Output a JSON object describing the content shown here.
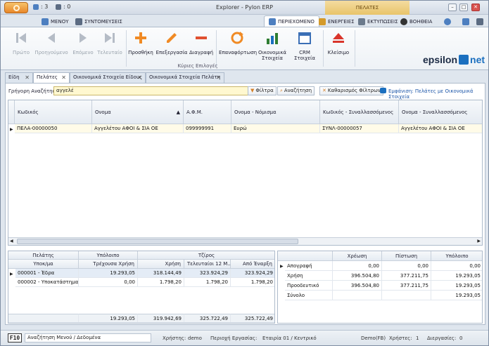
{
  "title_bar": {
    "counter1": ": 3",
    "counter2": ": 0",
    "menu": "ΜΕΝΟΥ",
    "shortcuts": "ΣΥΝΤΟΜΕΥΣΕΙΣ",
    "title": "Explorer - Pylon ERP",
    "context": "ΠΕΛΑΤΕΣ"
  },
  "ribbon_tabs": [
    {
      "label": "ΠΕΡΙΕΧΟΜΕΝΟ"
    },
    {
      "label": "ΕΝΕΡΓΕΙΕΣ"
    },
    {
      "label": "ΕΚΤΥΠΩΣΕΙΣ"
    },
    {
      "label": "ΒΟΗΘΕΙΑ"
    }
  ],
  "ribbon": {
    "buttons": [
      {
        "label": "Πρώτο",
        "icon": "first-icon"
      },
      {
        "label": "Προηγούμενο",
        "icon": "prev-icon"
      },
      {
        "label": "Επόμενο",
        "icon": "next-icon"
      },
      {
        "label": "Τελευταίο",
        "icon": "last-icon"
      },
      {
        "label": "Προσθήκη",
        "icon": "plus-icon"
      },
      {
        "label": "Επεξεργασία",
        "icon": "pencil-icon"
      },
      {
        "label": "Διαγραφή",
        "icon": "minus-icon"
      },
      {
        "label": "Επαναφόρτωση",
        "icon": "refresh-icon"
      },
      {
        "label": "Οικονομικά Στοιχεία",
        "icon": "chart-icon"
      },
      {
        "label": "CRM Στοιχεία",
        "icon": "calendar-icon"
      },
      {
        "label": "Κλείσιμο",
        "icon": "eject-icon"
      }
    ],
    "group_label": "Κύριες Επιλογές",
    "logo_left": "epsilon",
    "logo_right": "net"
  },
  "doc_tabs": [
    {
      "label": "Είδη"
    },
    {
      "label": "Πελάτες"
    },
    {
      "label": "Οικονομικά Στοιχεία Είδους"
    },
    {
      "label": "Οικονομικά Στοιχεία Πελάτη"
    }
  ],
  "search": {
    "label": "Γρήγορη Αναζήτηση",
    "value": "αγγελέ",
    "filters": "Φίλτρα",
    "search": "Αναζήτηση",
    "clear_filters": "Καθαρισμός Φίλτρων",
    "show_link": "Εμφάνιση: Πελάτες με Οικονομικά Στοιχεία"
  },
  "main_grid": {
    "columns": [
      "Κωδικός",
      "Ονομα",
      "Α.Φ.Μ.",
      "Ονομα - Νόμισμα",
      "Κωδικός - Συναλλασσόμενος",
      "Ονομα - Συναλλασσόμενος"
    ],
    "rows": [
      [
        "ΠΕΛΑ-00000050",
        "Αγγελέτου ΑΦΟΙ & ΣΙΑ ΟΕ",
        "099999991",
        "Ευρώ",
        "ΣΥΝΛ-00000057",
        "Αγγελέτου ΑΦΟΙ & ΣΙΑ ΟΕ"
      ]
    ]
  },
  "branch_grid": {
    "group_headers": [
      "Πελάτης",
      "Υπόλοιπο",
      "Τζίρος"
    ],
    "columns": [
      "Υποκ/μα",
      "Τρέχουσα Χρήση",
      "Χρήση",
      "Τελευταίοι 12 Μ...",
      "Από Έναρξη"
    ],
    "rows": [
      [
        "000001 - Έδρα",
        "19.293,05",
        "318.144,49",
        "323.924,29",
        "323.924,29"
      ],
      [
        "000002 - Υποκατάστημα...",
        "0,00",
        "1.798,20",
        "1.798,20",
        "1.798,20"
      ]
    ],
    "totals": [
      "",
      "19.293,05",
      "319.942,69",
      "325.722,49",
      "325.722,49"
    ]
  },
  "balance_grid": {
    "columns": [
      "",
      "Χρέωση",
      "Πίστωση",
      "Υπόλοιπο"
    ],
    "rows": [
      [
        "Απογραφή",
        "0,00",
        "0,00",
        "0,00"
      ],
      [
        "Χρήση",
        "396.504,80",
        "377.211,75",
        "19.293,05"
      ],
      [
        "Προοδευτικό",
        "396.504,80",
        "377.211,75",
        "19.293,05"
      ],
      [
        "Σύνολο",
        "",
        "",
        "19.293,05"
      ]
    ]
  },
  "status": {
    "f10": "F10",
    "box": "Αναζήτηση Μενού / Δεδομένα",
    "user_label": "Χρήστης:",
    "user": "demo",
    "area_label": "Περιοχή Εργασίας:",
    "area": "Εταιρία 01 / Κεντρικό",
    "db": "Demo(FB)",
    "users_label": "Χρήστες:",
    "users": "1",
    "tasks_label": "Διεργασίες:",
    "tasks": "0"
  },
  "colors": {
    "accent": "#1b6fbf",
    "search_bg": "#fff8d0",
    "plus": "#f08a24",
    "minus": "#e05030"
  }
}
